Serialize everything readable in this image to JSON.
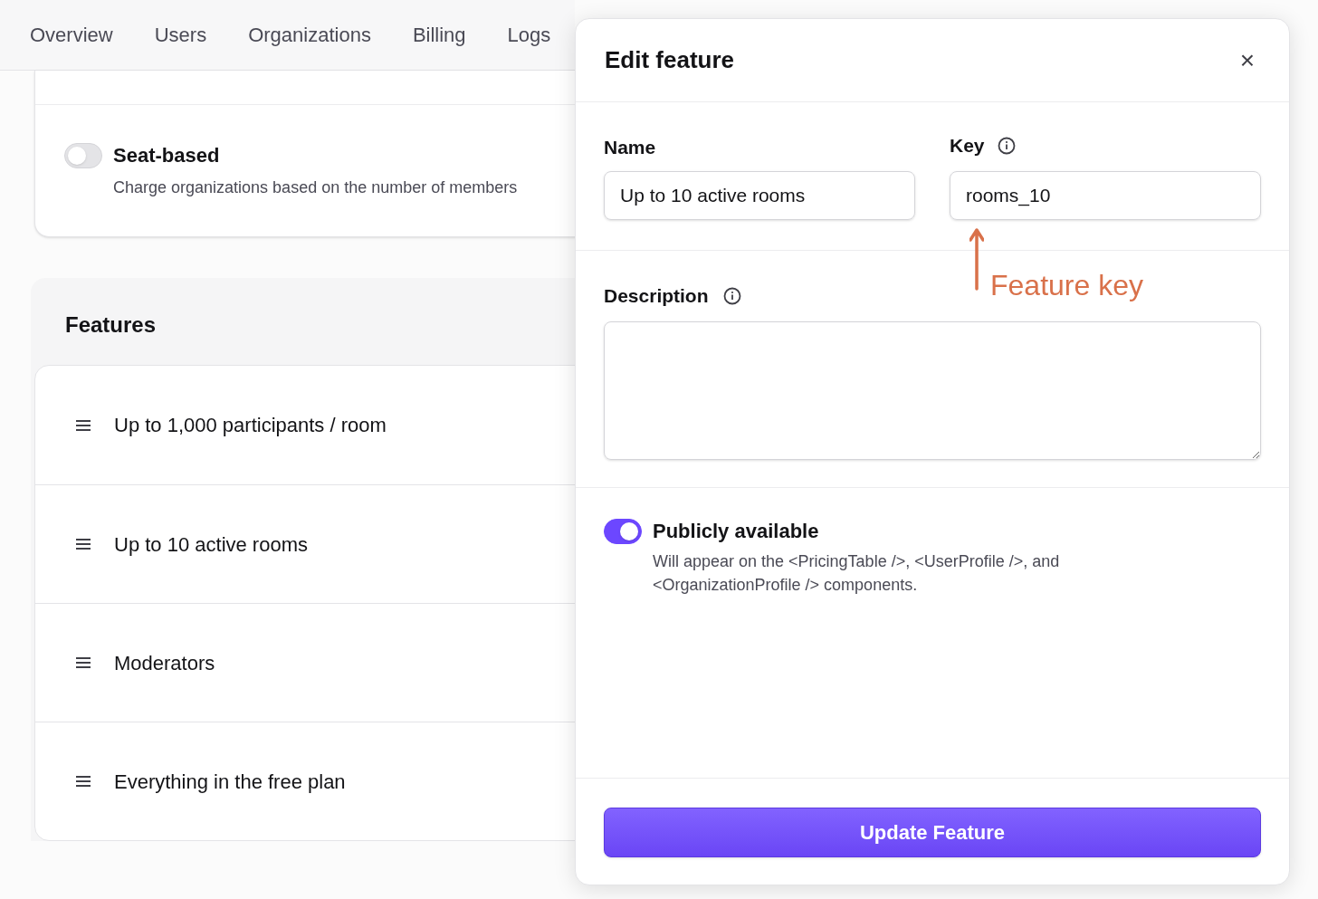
{
  "nav": {
    "tabs": [
      "Overview",
      "Users",
      "Organizations",
      "Billing",
      "Logs"
    ]
  },
  "pricing_options": [
    {
      "title": "Seat-based",
      "description": "Charge organizations based on the number of members",
      "on": false
    }
  ],
  "features": {
    "title": "Features",
    "items": [
      "Up to 1,000 participants / room",
      "Up to 10 active rooms",
      "Moderators",
      "Everything in the free plan"
    ]
  },
  "modal": {
    "title": "Edit feature",
    "close": "×",
    "name_label": "Name",
    "name_value": "Up to 10 active rooms",
    "key_label": "Key",
    "key_value": "rooms_10",
    "description_label": "Description",
    "public": {
      "title": "Publicly available",
      "description": "Will appear on the <PricingTable />, <UserProfile />, and <OrganizationProfile /> components.",
      "on": true
    },
    "submit": "Update Feature"
  },
  "annotation": {
    "text": "Feature key"
  }
}
